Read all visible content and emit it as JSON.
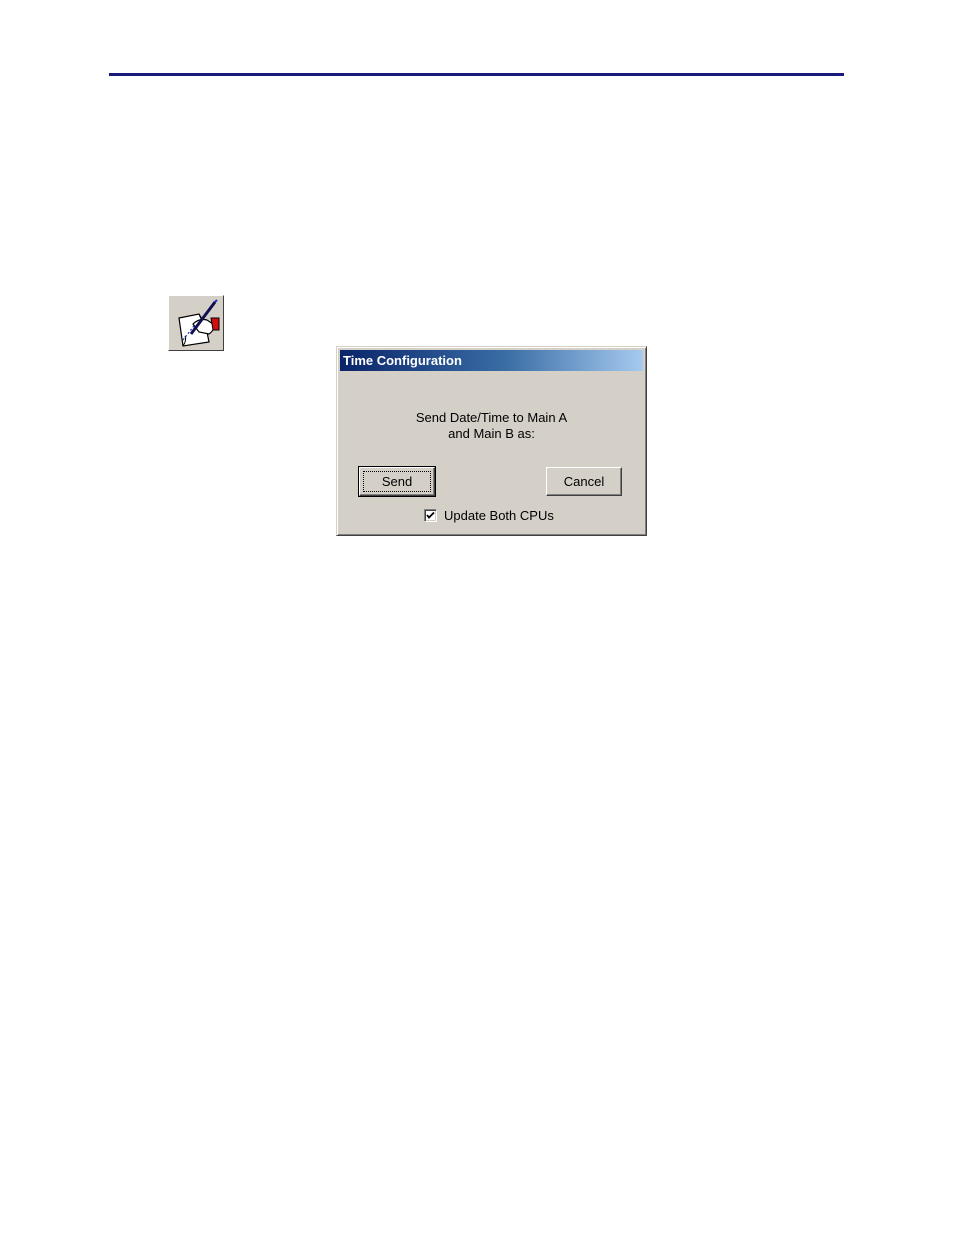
{
  "dialog": {
    "title": "Time Configuration",
    "message_line1": "Send Date/Time to Main A",
    "message_line2": "and Main B as:",
    "send_label": "Send",
    "cancel_label": "Cancel",
    "update_both_label": "Update Both CPUs",
    "update_both_checked": true
  },
  "icons": {
    "toolbar_icon": "write-time-icon"
  },
  "colors": {
    "rule": "#1a1a78",
    "titlebar_start": "#0a246a",
    "titlebar_end": "#a6caf0",
    "dialog_face": "#d4d0c8"
  }
}
